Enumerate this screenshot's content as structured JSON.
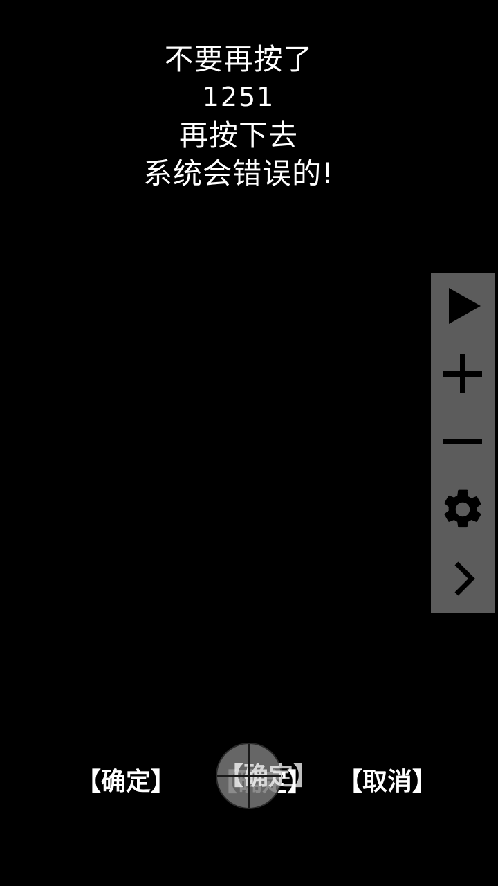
{
  "message": {
    "line1": "不要再按了",
    "counter": "1251",
    "line3": "再按下去",
    "line4": "系统会错误的!"
  },
  "side_panel": {
    "background": "#5c5c5c",
    "icon_color": "#000000",
    "items": [
      {
        "icon": "play-icon"
      },
      {
        "icon": "plus-icon"
      },
      {
        "icon": "minus-icon"
      },
      {
        "icon": "gear-icon"
      },
      {
        "icon": "chevron-right-icon"
      }
    ]
  },
  "buttons": {
    "confirm_left": "【确定】",
    "confirm_center": "【确定】",
    "cancel": "【取消】"
  }
}
